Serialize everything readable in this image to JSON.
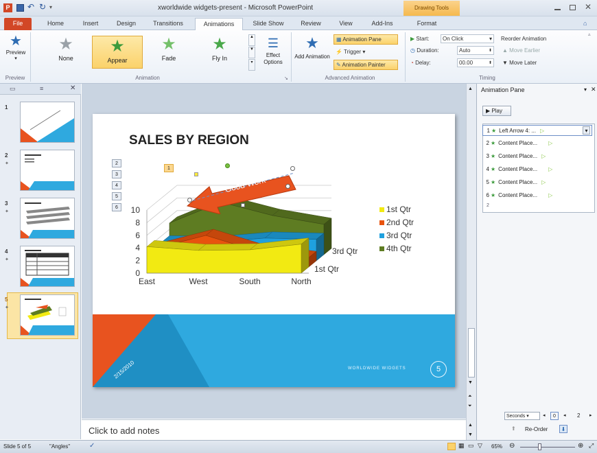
{
  "titlebar": {
    "title": "xworldwide widgets-present - Microsoft PowerPoint",
    "context_label": "Drawing Tools"
  },
  "tabs": [
    "File",
    "Home",
    "Insert",
    "Design",
    "Transitions",
    "Animations",
    "Slide Show",
    "Review",
    "View",
    "Add-Ins",
    "Format"
  ],
  "ribbon": {
    "preview": {
      "label": "Preview",
      "group": "Preview"
    },
    "animations": [
      {
        "label": "None"
      },
      {
        "label": "Appear"
      },
      {
        "label": "Fade"
      },
      {
        "label": "Fly In"
      }
    ],
    "effect_options": "Effect Options",
    "animation_group": "Animation",
    "add_animation": "Add Animation",
    "animation_pane": "Animation Pane",
    "trigger": "Trigger",
    "animation_painter": "Animation Painter",
    "advanced_group": "Advanced Animation",
    "start_label": "Start:",
    "start_value": "On Click",
    "duration_label": "Duration:",
    "duration_value": "Auto",
    "delay_label": "Delay:",
    "delay_value": "00.00",
    "timing_group": "Timing",
    "reorder_label": "Reorder Animation",
    "move_earlier": "Move Earlier",
    "move_later": "Move Later"
  },
  "slides": [
    {
      "num": "1"
    },
    {
      "num": "2"
    },
    {
      "num": "3"
    },
    {
      "num": "4"
    },
    {
      "num": "5"
    }
  ],
  "slide": {
    "title": "SALES BY REGION",
    "arrow_text": "Good Work",
    "footer": "WORLDWIDE WIDGETS",
    "page_num": "5",
    "date": "2/15/2010",
    "anim_tags": [
      "2",
      "3",
      "4",
      "5",
      "6"
    ],
    "anim_tag_top": "1"
  },
  "chart_data": {
    "type": "area",
    "categories": [
      "East",
      "West",
      "South",
      "North"
    ],
    "yticks": [
      "0",
      "2",
      "4",
      "6",
      "8",
      "10"
    ],
    "depth_labels": [
      "3rd Qtr",
      "1st Qtr"
    ],
    "ylim": [
      0,
      10
    ],
    "series": [
      {
        "name": "1st Qtr",
        "color": "#f2ea12",
        "values": [
          4.2,
          3.6,
          3.7,
          4.6
        ]
      },
      {
        "name": "2nd Qtr",
        "color": "#e8530e",
        "values": [
          2.9,
          5.0,
          2.5,
          1.5
        ]
      },
      {
        "name": "3rd Qtr",
        "color": "#1fa0de",
        "values": [
          3.0,
          2.9,
          3.6,
          3.4
        ]
      },
      {
        "name": "4th Qtr",
        "color": "#5e7c22",
        "values": [
          5.0,
          8.3,
          6.2,
          4.8
        ]
      }
    ]
  },
  "notes": "Click to add notes",
  "anim_pane": {
    "title": "Animation Pane",
    "play": "Play",
    "items": [
      {
        "num": "1",
        "label": "Left Arrow 4: ..."
      },
      {
        "num": "2",
        "label": "Content Place..."
      },
      {
        "num": "3",
        "label": "Content Place..."
      },
      {
        "num": "4",
        "label": "Content Place..."
      },
      {
        "num": "5",
        "label": "Content Place..."
      },
      {
        "num": "6",
        "label": "Content Place..."
      }
    ],
    "extra": "2",
    "seconds": "Seconds",
    "tl_start": "0",
    "tl_end": "2",
    "reorder": "Re-Order"
  },
  "status": {
    "slide": "Slide 5 of 5",
    "theme": "\"Angles\"",
    "zoom": "65%"
  }
}
